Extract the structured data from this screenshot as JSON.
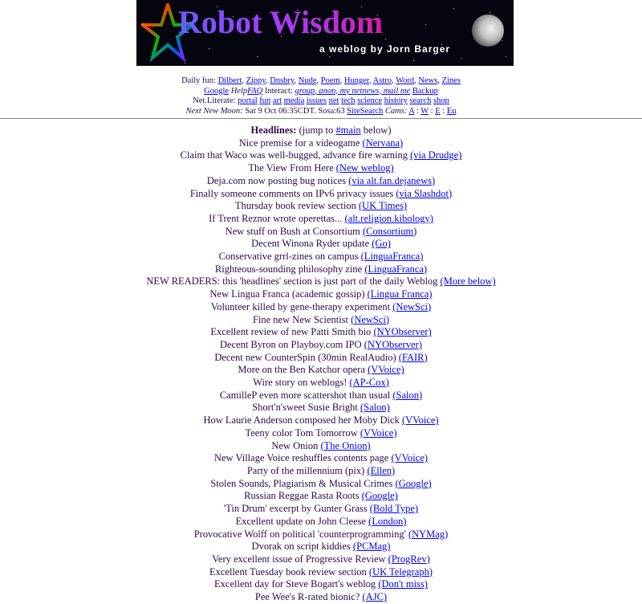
{
  "banner": {
    "title": "Robot Wisdom",
    "byline": "a weblog by Jorn Barger"
  },
  "nav": {
    "daily_fun_label": "Daily fun:",
    "daily_fun_links": [
      "Dilbert",
      "Zippy",
      "Dnsbry",
      "Nude",
      "Poem",
      "Hunger",
      "Astro",
      "Word",
      "News",
      "Zines"
    ],
    "help_label": "Help",
    "help_links": [
      "Google",
      "FAQ"
    ],
    "interact_label": "Interact:",
    "interact_link": "group, anon, my netnews, mail me",
    "backup": "Backup",
    "netliterate_label": "Net.Literate:",
    "netliterate_links": [
      "portal",
      "fun",
      "art",
      "media",
      "issues",
      "net",
      "tech",
      "science",
      "history",
      "search",
      "shop"
    ],
    "moon_label": "Next New Moon:",
    "moon_date": "Sat 9 Oct 06:35CDT. Sosa:63",
    "sitesearch": "SiteSearch",
    "cams_label": "Cams:",
    "cams_links": [
      "A",
      "W",
      "E",
      "Eu"
    ]
  },
  "headlines": {
    "header_bold": "Headlines:",
    "header_pre": "(jump to",
    "header_link": "#main",
    "header_post": "below)",
    "items": [
      {
        "text": "Nice premise for a videogame",
        "source": "(Nervana)"
      },
      {
        "text": "Claim that Waco was well-bugged, advance fire warning",
        "source": "(via Drudge)"
      },
      {
        "text": "The View From Here",
        "source": "(New weblog)"
      },
      {
        "text": "Deja.com now posting bug notices",
        "source": "(via alt.fan.dejanews)"
      },
      {
        "text": "Finally someone comments on IPv6 privacy issues",
        "source": "(via Slashdot)"
      },
      {
        "text": "Thursday book review section",
        "source": "(UK Times)"
      },
      {
        "text": "If Trent Reznor wrote operettas...",
        "source": "(alt.religion.kibology)"
      },
      {
        "text": "New stuff on Bush at Consortium",
        "source": "(Consortium)"
      },
      {
        "text": "Decent Winona Ryder update",
        "source": "(Go)"
      },
      {
        "text": "Conservative grrl-zines on campus",
        "source": "(LinguaFranca)"
      },
      {
        "text": "Righteous-sounding philosophy zine",
        "source": "(LinguaFranca)"
      },
      {
        "text": "NEW READERS: this 'headlines' section is just part of the daily Weblog",
        "source": "(More below)"
      },
      {
        "text": "New Lingua Franca (academic gossip)",
        "source": "(Lingua Franca)"
      },
      {
        "text": "Volunteer killed by gene-therapy experiment",
        "source": "(NewSci)"
      },
      {
        "text": "Fine new New Scientist",
        "source": "(NewSci)"
      },
      {
        "text": "Excellent review of new Patti Smith bio",
        "source": "(NYObserver)"
      },
      {
        "text": "Decent Byron on Playboy.com IPO",
        "source": "(NYObserver)"
      },
      {
        "text": "Decent new CounterSpin (30min RealAudio)",
        "source": "(FAIR)"
      },
      {
        "text": "More on the Ben Katchor opera",
        "source": "(VVoice)"
      },
      {
        "text": "Wire story on weblogs!",
        "source": "(AP-Cox)"
      },
      {
        "text": "CamilleP even more scattershot than usual",
        "source": "(Salon)"
      },
      {
        "text": "Short'n'sweet Susie Bright",
        "source": "(Salon)"
      },
      {
        "text": "How Laurie Anderson composed her Moby Dick",
        "source": "(VVoice)"
      },
      {
        "text": "Teeny color Tom Tomorrow",
        "source": "(VVoice)"
      },
      {
        "text": "New Onion",
        "source": "(The Onion)"
      },
      {
        "text": "New Village Voice reshuffles contents page",
        "source": "(VVoice)"
      },
      {
        "text": "Party of the millennium (pix)",
        "source": "(Ellen)"
      },
      {
        "text": "Stolen Sounds, Plagiarism & Musical Crimes",
        "source": "(Google)"
      },
      {
        "text": "Russian Reggae Rasta Roots",
        "source": "(Google)"
      },
      {
        "text": "'Tin Drum' excerpt by Gunter Grass",
        "source": "(Bold Type)"
      },
      {
        "text": "Excellent update on John Cleese",
        "source": "(London)"
      },
      {
        "text": "Provocative Wolff on political 'counterprogramming'",
        "source": "(NYMag)"
      },
      {
        "text": "Dvorak on script kiddies",
        "source": "(PCMag)"
      },
      {
        "text": "Very excellent issue of Progressive Review",
        "source": "(ProgRev)"
      },
      {
        "text": "Excellent Tuesday book review section",
        "source": "(UK Telegraph)"
      },
      {
        "text": "Excellent day for Steve Bogart's weblog",
        "source": "(Don't miss)"
      },
      {
        "text": "Pee Wee's R-rated bionic?",
        "source": "(AJC)"
      }
    ]
  }
}
